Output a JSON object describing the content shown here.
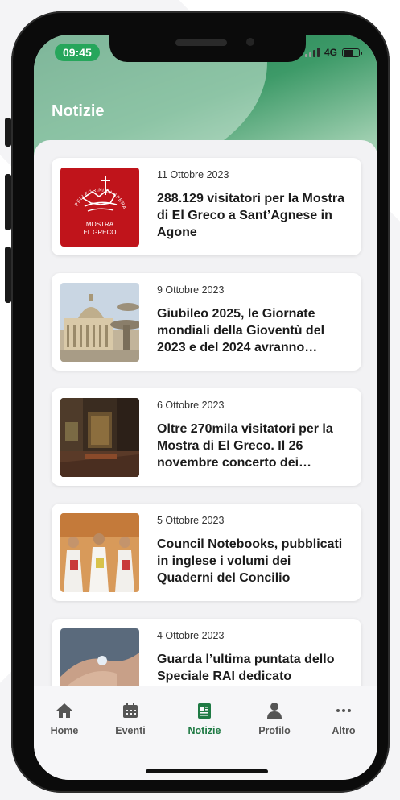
{
  "status_bar": {
    "time": "09:45",
    "network": "4G",
    "battery_level": 0.7
  },
  "header": {
    "title": "Notizie"
  },
  "news": [
    {
      "date": "11 Ottobre 2023",
      "title": "288.129 visitatori per la Mostra di El Greco a Sant’Agnese in Agone",
      "thumb": "logo",
      "thumb_caption_1": "MOSTRA",
      "thumb_caption_2": "EL GRECO",
      "thumb_arc_text": "PELLEGRINI DI SPERANZA"
    },
    {
      "date": "9 Ottobre 2023",
      "title": "Giubileo 2025, le Giornate mondiali della Gioventù del 2023 e del 2024 avranno…",
      "thumb": "basilica-photo"
    },
    {
      "date": "6 Ottobre 2023",
      "title": "Oltre 270mila visitatori per la Mostra di El Greco. Il 26 novembre concerto dei…",
      "thumb": "church-interior-photo"
    },
    {
      "date": "5 Ottobre 2023",
      "title": "Council Notebooks, pubblicati in inglese i volumi dei Quaderni del Concilio",
      "thumb": "clergy-photo"
    },
    {
      "date": "4 Ottobre 2023",
      "title": "Guarda l’ultima puntata dello Speciale RAI dedicato",
      "thumb": "hands-photo"
    }
  ],
  "tabs": [
    {
      "label": "Home",
      "icon": "home-icon",
      "active": false
    },
    {
      "label": "Eventi",
      "icon": "calendar-icon",
      "active": false
    },
    {
      "label": "Notizie",
      "icon": "news-icon",
      "active": true
    },
    {
      "label": "Profilo",
      "icon": "profile-icon",
      "active": false
    },
    {
      "label": "Altro",
      "icon": "more-icon",
      "active": false
    }
  ],
  "colors": {
    "accent": "#1f7a44",
    "time_pill": "#26a65b",
    "logo_red": "#c0141b"
  }
}
